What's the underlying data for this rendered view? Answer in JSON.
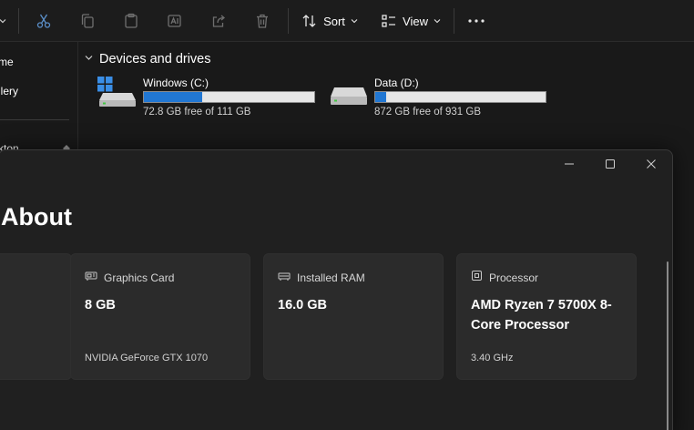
{
  "explorer": {
    "toolbar": {
      "sort_label": "Sort",
      "view_label": "View",
      "icons": [
        "chevron-down-icon",
        "cut-icon",
        "copy-icon",
        "paste-icon",
        "rename-icon",
        "share-icon",
        "delete-icon",
        "sort-icon",
        "view-icon",
        "more-icon"
      ]
    },
    "nav": {
      "items": [
        {
          "label": "me"
        },
        {
          "label": "llery"
        },
        {
          "label": "kton"
        }
      ]
    },
    "devices": {
      "title": "Devices and drives",
      "drives": [
        {
          "name": "Windows (C:)",
          "free_text": "72.8 GB free of 111 GB",
          "used_fraction": 0.344,
          "icon": "windows-drive-icon"
        },
        {
          "name": "Data (D:)",
          "free_text": "872 GB free of 931 GB",
          "used_fraction": 0.063,
          "icon": "hard-drive-icon"
        }
      ]
    }
  },
  "settings": {
    "title": "About",
    "window_controls": [
      "minimize-icon",
      "maximize-icon",
      "close-icon"
    ],
    "cards": [
      {
        "label": "Graphics Card",
        "value": "8 GB",
        "sub": "NVIDIA GeForce GTX 1070",
        "icon": "graphics-card-icon"
      },
      {
        "label": "Installed RAM",
        "value": "16.0 GB",
        "sub": "",
        "icon": "ram-icon"
      },
      {
        "label": "Processor",
        "value": "AMD Ryzen 7 5700X 8-Core Processor",
        "sub": "3.40 GHz",
        "icon": "processor-icon"
      }
    ],
    "colors": {
      "accent": "#2177d3",
      "card_bg": "#2b2b2b",
      "window_bg": "#202020"
    }
  }
}
